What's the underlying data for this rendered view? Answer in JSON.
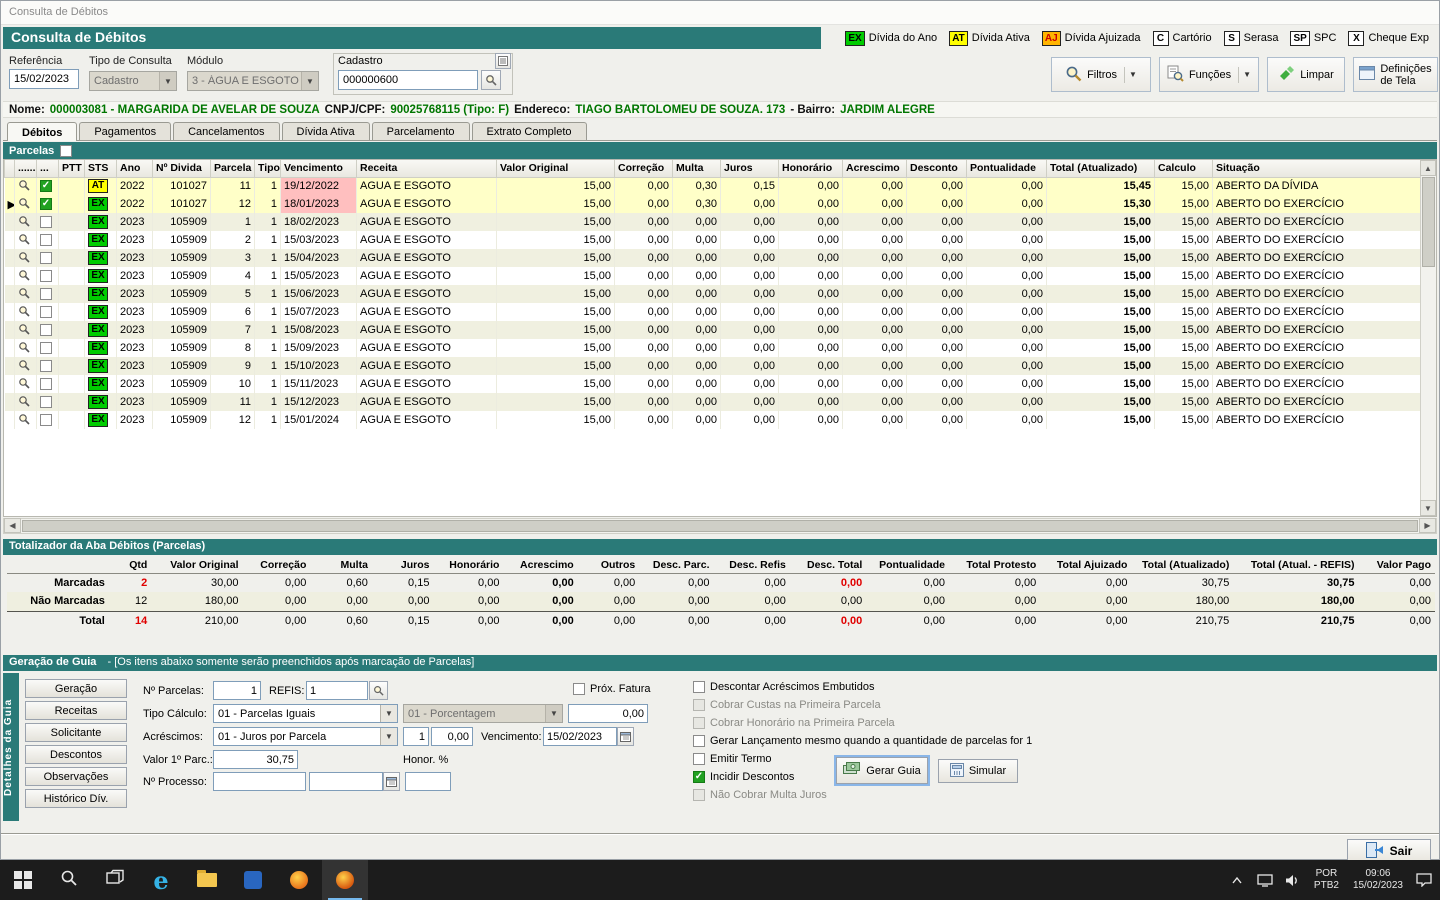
{
  "colors": {
    "accent": "#2a7a78",
    "green": "#007600",
    "red": "#e00000"
  },
  "window": {
    "title": "Consulta de Débitos"
  },
  "header": {
    "title": "Consulta de Débitos",
    "legend": [
      {
        "badge": "EX",
        "label": "Dívida do Ano",
        "bg": "#00cc00",
        "fg": "#000000"
      },
      {
        "badge": "AT",
        "label": "Dívida Ativa",
        "bg": "#ffff00",
        "fg": "#000000"
      },
      {
        "badge": "AJ",
        "label": "Dívida Ajuizada",
        "bg": "#ffb400",
        "fg": "#cc0000"
      },
      {
        "badge": "C",
        "label": "Cartório",
        "bg": "#ffffff",
        "fg": "#000000"
      },
      {
        "badge": "S",
        "label": "Serasa",
        "bg": "#ffffff",
        "fg": "#000000"
      },
      {
        "badge": "SP",
        "label": "SPC",
        "bg": "#ffffff",
        "fg": "#000000"
      },
      {
        "badge": "X",
        "label": "Cheque Exp",
        "bg": "#ffffff",
        "fg": "#000000"
      }
    ]
  },
  "toolbar": {
    "referencia_label": "Referência",
    "referencia": "15/02/2023",
    "tipo_consulta_label": "Tipo de Consulta",
    "tipo_consulta": "Cadastro",
    "modulo_label": "Módulo",
    "modulo": "3 - ÁGUA E ESGOTO",
    "cadastro_label": "Cadastro",
    "cadastro": "000000600",
    "filtros": "Filtros",
    "funcoes": "Funções",
    "limpar": "Limpar",
    "definicoes_l1": "Definições",
    "definicoes_l2": "de Tela"
  },
  "info": {
    "nome_label": "Nome:",
    "nome": "000003081 - MARGARIDA DE AVELAR DE SOUZA",
    "cnpj_label": "CNPJ/CPF:",
    "cnpj": "90025768115 (Tipo: F)",
    "endereco_label": "Endereco:",
    "endereco": "TIAGO BARTOLOMEU DE SOUZA. 173",
    "bairro_label": "- Bairro:",
    "bairro": "JARDIM ALEGRE"
  },
  "tabs": [
    "Débitos",
    "Pagamentos",
    "Cancelamentos",
    "Dívida Ativa",
    "Parcelamento",
    "Extrato Completo"
  ],
  "active_tab": "Débitos",
  "parcelas_label": "Parcelas",
  "sts_colors": {
    "EX": "#00cc00",
    "AT": "#ffff00"
  },
  "grid": {
    "columns": [
      "",
      "......",
      "...",
      "PTT",
      "STS",
      "Ano",
      "Nº Divida",
      "Parcela",
      "Tipo",
      "Vencimento",
      "Receita",
      "Valor Original",
      "Correção",
      "Multa",
      "Juros",
      "Honorário",
      "Acrescimo",
      "Desconto",
      "Pontualidade",
      "Total (Atualizado)",
      "Calculo",
      "Situação"
    ],
    "rows": [
      {
        "current": false,
        "checked": true,
        "sts": "AT",
        "ano": "2022",
        "divida": "101027",
        "parcela": "11",
        "tipo": "1",
        "venc": "19/12/2022",
        "overdue": true,
        "receita": "AGUA E ESGOTO",
        "valor": "15,00",
        "correcao": "0,00",
        "multa": "0,30",
        "juros": "0,15",
        "honorario": "0,00",
        "acrescimo": "0,00",
        "desconto": "0,00",
        "pontualidade": "0,00",
        "total": "15,45",
        "calculo": "15,00",
        "situacao": "ABERTO DA DÍVIDA"
      },
      {
        "current": true,
        "checked": true,
        "sts": "EX",
        "ano": "2022",
        "divida": "101027",
        "parcela": "12",
        "tipo": "1",
        "venc": "18/01/2023",
        "overdue": true,
        "receita": "AGUA E ESGOTO",
        "valor": "15,00",
        "correcao": "0,00",
        "multa": "0,30",
        "juros": "0,00",
        "honorario": "0,00",
        "acrescimo": "0,00",
        "desconto": "0,00",
        "pontualidade": "0,00",
        "total": "15,30",
        "calculo": "15,00",
        "situacao": "ABERTO DO EXERCÍCIO"
      },
      {
        "current": false,
        "checked": false,
        "sts": "EX",
        "ano": "2023",
        "divida": "105909",
        "parcela": "1",
        "tipo": "1",
        "venc": "18/02/2023",
        "overdue": false,
        "receita": "AGUA E ESGOTO",
        "valor": "15,00",
        "correcao": "0,00",
        "multa": "0,00",
        "juros": "0,00",
        "honorario": "0,00",
        "acrescimo": "0,00",
        "desconto": "0,00",
        "pontualidade": "0,00",
        "total": "15,00",
        "calculo": "15,00",
        "situacao": "ABERTO DO EXERCÍCIO"
      },
      {
        "current": false,
        "checked": false,
        "sts": "EX",
        "ano": "2023",
        "divida": "105909",
        "parcela": "2",
        "tipo": "1",
        "venc": "15/03/2023",
        "overdue": false,
        "receita": "AGUA E ESGOTO",
        "valor": "15,00",
        "correcao": "0,00",
        "multa": "0,00",
        "juros": "0,00",
        "honorario": "0,00",
        "acrescimo": "0,00",
        "desconto": "0,00",
        "pontualidade": "0,00",
        "total": "15,00",
        "calculo": "15,00",
        "situacao": "ABERTO DO EXERCÍCIO"
      },
      {
        "current": false,
        "checked": false,
        "sts": "EX",
        "ano": "2023",
        "divida": "105909",
        "parcela": "3",
        "tipo": "1",
        "venc": "15/04/2023",
        "overdue": false,
        "receita": "AGUA E ESGOTO",
        "valor": "15,00",
        "correcao": "0,00",
        "multa": "0,00",
        "juros": "0,00",
        "honorario": "0,00",
        "acrescimo": "0,00",
        "desconto": "0,00",
        "pontualidade": "0,00",
        "total": "15,00",
        "calculo": "15,00",
        "situacao": "ABERTO DO EXERCÍCIO"
      },
      {
        "current": false,
        "checked": false,
        "sts": "EX",
        "ano": "2023",
        "divida": "105909",
        "parcela": "4",
        "tipo": "1",
        "venc": "15/05/2023",
        "overdue": false,
        "receita": "AGUA E ESGOTO",
        "valor": "15,00",
        "correcao": "0,00",
        "multa": "0,00",
        "juros": "0,00",
        "honorario": "0,00",
        "acrescimo": "0,00",
        "desconto": "0,00",
        "pontualidade": "0,00",
        "total": "15,00",
        "calculo": "15,00",
        "situacao": "ABERTO DO EXERCÍCIO"
      },
      {
        "current": false,
        "checked": false,
        "sts": "EX",
        "ano": "2023",
        "divida": "105909",
        "parcela": "5",
        "tipo": "1",
        "venc": "15/06/2023",
        "overdue": false,
        "receita": "AGUA E ESGOTO",
        "valor": "15,00",
        "correcao": "0,00",
        "multa": "0,00",
        "juros": "0,00",
        "honorario": "0,00",
        "acrescimo": "0,00",
        "desconto": "0,00",
        "pontualidade": "0,00",
        "total": "15,00",
        "calculo": "15,00",
        "situacao": "ABERTO DO EXERCÍCIO"
      },
      {
        "current": false,
        "checked": false,
        "sts": "EX",
        "ano": "2023",
        "divida": "105909",
        "parcela": "6",
        "tipo": "1",
        "venc": "15/07/2023",
        "overdue": false,
        "receita": "AGUA E ESGOTO",
        "valor": "15,00",
        "correcao": "0,00",
        "multa": "0,00",
        "juros": "0,00",
        "honorario": "0,00",
        "acrescimo": "0,00",
        "desconto": "0,00",
        "pontualidade": "0,00",
        "total": "15,00",
        "calculo": "15,00",
        "situacao": "ABERTO DO EXERCÍCIO"
      },
      {
        "current": false,
        "checked": false,
        "sts": "EX",
        "ano": "2023",
        "divida": "105909",
        "parcela": "7",
        "tipo": "1",
        "venc": "15/08/2023",
        "overdue": false,
        "receita": "AGUA E ESGOTO",
        "valor": "15,00",
        "correcao": "0,00",
        "multa": "0,00",
        "juros": "0,00",
        "honorario": "0,00",
        "acrescimo": "0,00",
        "desconto": "0,00",
        "pontualidade": "0,00",
        "total": "15,00",
        "calculo": "15,00",
        "situacao": "ABERTO DO EXERCÍCIO"
      },
      {
        "current": false,
        "checked": false,
        "sts": "EX",
        "ano": "2023",
        "divida": "105909",
        "parcela": "8",
        "tipo": "1",
        "venc": "15/09/2023",
        "overdue": false,
        "receita": "AGUA E ESGOTO",
        "valor": "15,00",
        "correcao": "0,00",
        "multa": "0,00",
        "juros": "0,00",
        "honorario": "0,00",
        "acrescimo": "0,00",
        "desconto": "0,00",
        "pontualidade": "0,00",
        "total": "15,00",
        "calculo": "15,00",
        "situacao": "ABERTO DO EXERCÍCIO"
      },
      {
        "current": false,
        "checked": false,
        "sts": "EX",
        "ano": "2023",
        "divida": "105909",
        "parcela": "9",
        "tipo": "1",
        "venc": "15/10/2023",
        "overdue": false,
        "receita": "AGUA E ESGOTO",
        "valor": "15,00",
        "correcao": "0,00",
        "multa": "0,00",
        "juros": "0,00",
        "honorario": "0,00",
        "acrescimo": "0,00",
        "desconto": "0,00",
        "pontualidade": "0,00",
        "total": "15,00",
        "calculo": "15,00",
        "situacao": "ABERTO DO EXERCÍCIO"
      },
      {
        "current": false,
        "checked": false,
        "sts": "EX",
        "ano": "2023",
        "divida": "105909",
        "parcela": "10",
        "tipo": "1",
        "venc": "15/11/2023",
        "overdue": false,
        "receita": "AGUA E ESGOTO",
        "valor": "15,00",
        "correcao": "0,00",
        "multa": "0,00",
        "juros": "0,00",
        "honorario": "0,00",
        "acrescimo": "0,00",
        "desconto": "0,00",
        "pontualidade": "0,00",
        "total": "15,00",
        "calculo": "15,00",
        "situacao": "ABERTO DO EXERCÍCIO"
      },
      {
        "current": false,
        "checked": false,
        "sts": "EX",
        "ano": "2023",
        "divida": "105909",
        "parcela": "11",
        "tipo": "1",
        "venc": "15/12/2023",
        "overdue": false,
        "receita": "AGUA E ESGOTO",
        "valor": "15,00",
        "correcao": "0,00",
        "multa": "0,00",
        "juros": "0,00",
        "honorario": "0,00",
        "acrescimo": "0,00",
        "desconto": "0,00",
        "pontualidade": "0,00",
        "total": "15,00",
        "calculo": "15,00",
        "situacao": "ABERTO DO EXERCÍCIO"
      },
      {
        "current": false,
        "checked": false,
        "sts": "EX",
        "ano": "2023",
        "divida": "105909",
        "parcela": "12",
        "tipo": "1",
        "venc": "15/01/2024",
        "overdue": false,
        "receita": "AGUA E ESGOTO",
        "valor": "15,00",
        "correcao": "0,00",
        "multa": "0,00",
        "juros": "0,00",
        "honorario": "0,00",
        "acrescimo": "0,00",
        "desconto": "0,00",
        "pontualidade": "0,00",
        "total": "15,00",
        "calculo": "15,00",
        "situacao": "ABERTO DO EXERCÍCIO"
      }
    ]
  },
  "totalizador": {
    "title": "Totalizador da Aba Débitos (Parcelas)",
    "columns": [
      "",
      "Qtd",
      "Valor Original",
      "Correção",
      "Multa",
      "Juros",
      "Honorário",
      "Acrescimo",
      "Outros",
      "Desc. Parc.",
      "Desc. Refis",
      "Desc. Total",
      "Pontualidade",
      "Total Protesto",
      "Total Ajuizado",
      "Total (Atualizado)",
      "Total (Atual. - REFIS)",
      "Valor Pago"
    ],
    "rows": [
      {
        "label": "Marcadas",
        "values": [
          "2",
          "30,00",
          "0,00",
          "0,60",
          "0,15",
          "0,00",
          "0,00",
          "0,00",
          "0,00",
          "0,00",
          "0,00",
          "0,00",
          "0,00",
          "0,00",
          "30,75",
          "30,75",
          "0,00"
        ],
        "red": [
          0,
          10
        ],
        "total": false
      },
      {
        "label": "Não Marcadas",
        "values": [
          "12",
          "180,00",
          "0,00",
          "0,00",
          "0,00",
          "0,00",
          "0,00",
          "0,00",
          "0,00",
          "0,00",
          "0,00",
          "0,00",
          "0,00",
          "0,00",
          "180,00",
          "180,00",
          "0,00"
        ],
        "red": [],
        "total": false
      },
      {
        "label": "Total",
        "values": [
          "14",
          "210,00",
          "0,00",
          "0,60",
          "0,15",
          "0,00",
          "0,00",
          "0,00",
          "0,00",
          "0,00",
          "0,00",
          "0,00",
          "0,00",
          "0,00",
          "210,75",
          "210,75",
          "0,00"
        ],
        "red": [
          0,
          10
        ],
        "total": true
      }
    ],
    "bold_value_cols": [
      6,
      15
    ]
  },
  "geracao": {
    "title": "Geração de Guia",
    "subtitle": "-   [Os itens abaixo somente serão preenchidos após marcação de Parcelas]",
    "side_label": "Detalhes da Guia",
    "side_buttons": [
      "Geração",
      "Receitas",
      "Solicitante",
      "Descontos",
      "Observações",
      "Histórico Dív."
    ],
    "num_parcelas_label": "Nº Parcelas:",
    "num_parcelas": "1",
    "refis_label": "REFIS:",
    "refis": "1",
    "tipo_calculo_label": "Tipo Cálculo:",
    "tipo_calculo": "01 - Parcelas Iguais",
    "porcentagem": "01 - Porcentagem",
    "porcentagem_valor": "0,00",
    "acrescimos_label": "Acréscimos:",
    "acrescimos": "01 - Juros por Parcela",
    "acrescimos_qtd": "1",
    "acrescimos_valor": "0,00",
    "vencimento_label": "Vencimento:",
    "vencimento": "15/02/2023",
    "valor_parc_label": "Valor 1º Parc.:",
    "valor_parc": "30,75",
    "honor_label": "Honor. %",
    "processo_label": "Nº Processo:",
    "prox_fatura": "Próx. Fatura",
    "checkboxes": [
      {
        "label": "Descontar Acréscimos Embutidos",
        "checked": false,
        "disabled": false
      },
      {
        "label": "Cobrar Custas na Primeira Parcela",
        "checked": false,
        "disabled": true
      },
      {
        "label": "Cobrar Honorário na Primeira Parcela",
        "checked": false,
        "disabled": true
      },
      {
        "label": "Gerar Lançamento mesmo quando a quantidade de parcelas for 1",
        "checked": false,
        "disabled": false
      },
      {
        "label": "Emitir Termo",
        "checked": false,
        "disabled": false
      },
      {
        "label": "Incidir Descontos",
        "checked": true,
        "disabled": false
      },
      {
        "label": "Não Cobrar Multa Juros",
        "checked": false,
        "disabled": true
      }
    ],
    "gerar_guia": "Gerar Guia",
    "simular": "Simular"
  },
  "footer": {
    "sair": "Sair"
  },
  "taskbar": {
    "lang": "POR",
    "lang2": "PTB2",
    "time": "09:06",
    "date": "15/02/2023"
  }
}
